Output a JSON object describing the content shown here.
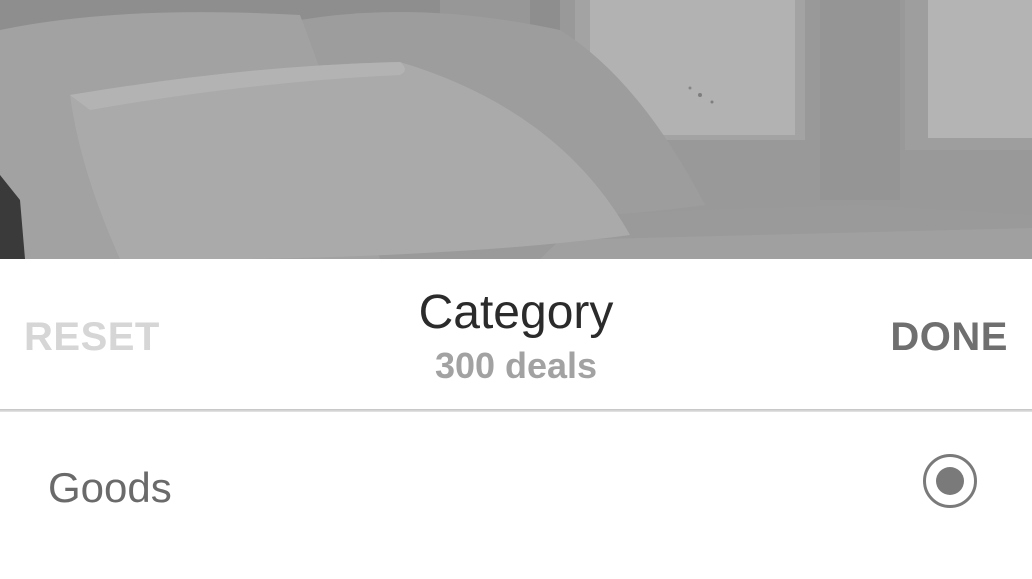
{
  "header": {
    "reset_label": "RESET",
    "title": "Category",
    "subtitle": "300 deals",
    "done_label": "DONE"
  },
  "options": [
    {
      "label": "Goods",
      "selected": true
    }
  ],
  "colors": {
    "title": "#2b2b2b",
    "subtitle": "#a2a2a2",
    "reset_disabled": "#d6d6d6",
    "done": "#6f6f6f",
    "option_text": "#6a6a6a",
    "radio": "#7a7a7a",
    "backdrop_dim": "#8c8c8c"
  }
}
